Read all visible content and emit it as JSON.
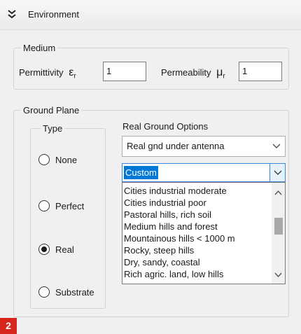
{
  "header": {
    "title": "Environment"
  },
  "medium": {
    "legend": "Medium",
    "permittivity_label": "Permittivity",
    "permittivity_symbol": "ε",
    "permittivity_sub": "r",
    "permittivity_value": "1",
    "permeability_label": "Permeability",
    "permeability_symbol": "μ",
    "permeability_sub": "r",
    "permeability_value": "1"
  },
  "ground_plane": {
    "legend": "Ground Plane",
    "type": {
      "legend": "Type",
      "options": [
        "None",
        "Perfect",
        "Real",
        "Substrate"
      ],
      "selected": "Real"
    },
    "real_ground": {
      "label": "Real Ground Options",
      "mode_value": "Real gnd under antenna",
      "soil_value": "Custom",
      "list_items": [
        "Cities industrial moderate",
        "Cities industrial poor",
        "Pastoral hills, rich soil",
        "Medium hills and forest",
        "Mountainous hills < 1000 m",
        "Rocky, steep hills",
        "Dry, sandy, coastal",
        "Rich agric. land, low hills"
      ]
    }
  },
  "badge": {
    "text": "2"
  },
  "colors": {
    "accent": "#0078d7",
    "badge": "#d9261c"
  }
}
